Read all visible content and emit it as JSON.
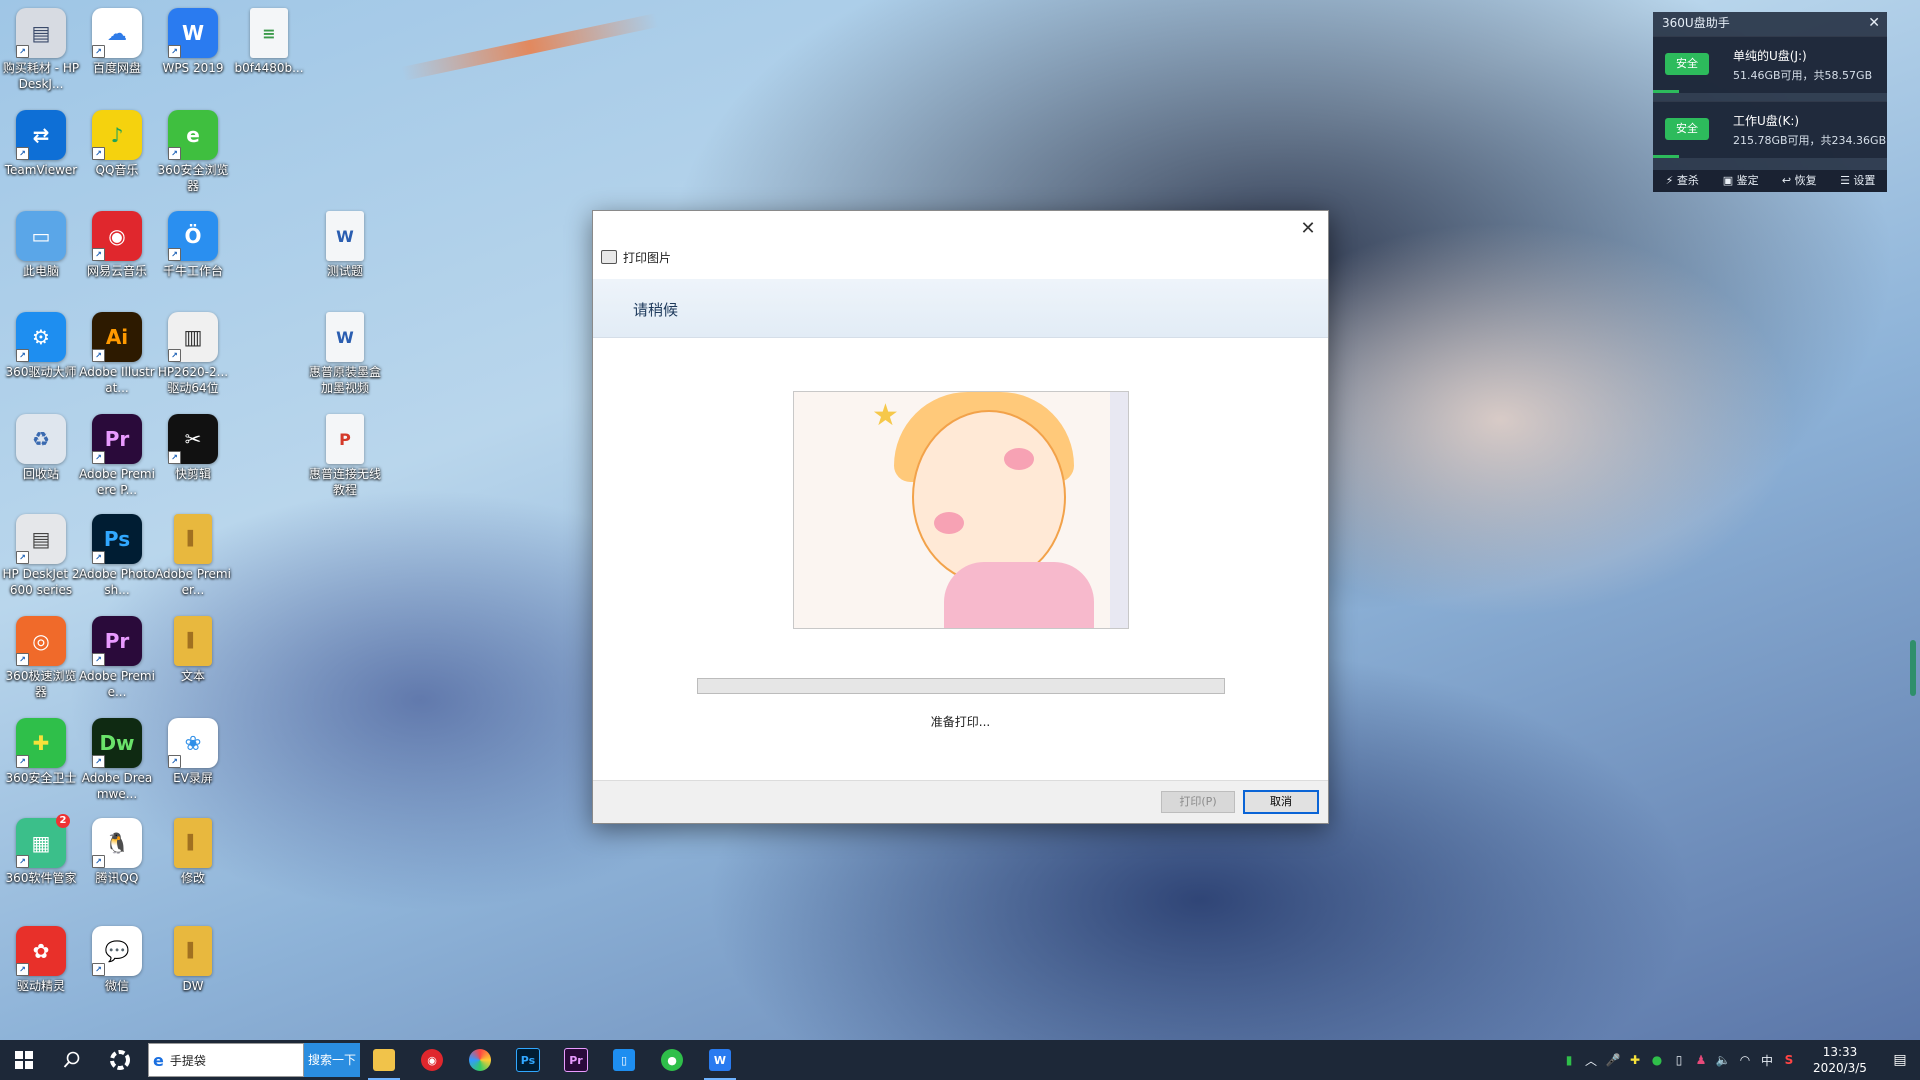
{
  "desktop_icons": [
    {
      "label": "购买耗材 - HP DeskJ...",
      "glyph": "▤",
      "color": "#d7dbe2",
      "glyph_color": "#3a4a6a",
      "shortcut": true
    },
    {
      "label": "百度网盘",
      "glyph": "☁",
      "color": "#ffffff",
      "glyph_color": "#2f7be8",
      "shortcut": true
    },
    {
      "label": "WPS 2019",
      "glyph": "W",
      "color": "#2a7bf0",
      "glyph_color": "#ffffff",
      "shortcut": true
    },
    {
      "label": "b0f4480b...",
      "glyph": "≡",
      "color": "#f4f6f8",
      "glyph_color": "#3a9a4a",
      "shortcut": false,
      "kind": "doc"
    },
    {
      "label": "TeamViewer",
      "glyph": "⇄",
      "color": "#0e6fd6",
      "glyph_color": "#ffffff",
      "shortcut": true
    },
    {
      "label": "QQ音乐",
      "glyph": "♪",
      "color": "#f5d20e",
      "glyph_color": "#1fa35a",
      "shortcut": true
    },
    {
      "label": "360安全浏览器",
      "glyph": "e",
      "color": "#3fbf3f",
      "glyph_color": "#ffffff",
      "shortcut": true
    },
    {
      "label": "此电脑",
      "glyph": "▭",
      "color": "#5aa6e8",
      "glyph_color": "#ffffff",
      "shortcut": false
    },
    {
      "label": "网易云音乐",
      "glyph": "◉",
      "color": "#e0272d",
      "glyph_color": "#ffffff",
      "shortcut": true
    },
    {
      "label": "千牛工作台",
      "glyph": "Ö",
      "color": "#2a8ff0",
      "glyph_color": "#ffffff",
      "shortcut": true
    },
    {
      "label": "测试题",
      "glyph": "W",
      "color": "#f4f6f8",
      "glyph_color": "#2a5db0",
      "shortcut": false,
      "kind": "doc"
    },
    {
      "label": "360驱动大师",
      "glyph": "⚙",
      "color": "#1e8ef0",
      "glyph_color": "#ffffff",
      "shortcut": true
    },
    {
      "label": "Adobe Illustrat...",
      "glyph": "Ai",
      "color": "#2d1a00",
      "glyph_color": "#ff9a00",
      "shortcut": true
    },
    {
      "label": "HP2620-2... 驱动64位",
      "glyph": "▥",
      "color": "#f0f0f0",
      "glyph_color": "#333333",
      "shortcut": true
    },
    {
      "label": "惠普原装墨盒加墨视频",
      "glyph": "W",
      "color": "#f4f6f8",
      "glyph_color": "#2a5db0",
      "shortcut": false,
      "kind": "doc"
    },
    {
      "label": "回收站",
      "glyph": "♻",
      "color": "#dfe6ee",
      "glyph_color": "#3a6ab0",
      "shortcut": false
    },
    {
      "label": "Adobe Premiere P...",
      "glyph": "Pr",
      "color": "#2a0a3a",
      "glyph_color": "#e99bff",
      "shortcut": true
    },
    {
      "label": "快剪辑",
      "glyph": "✂",
      "color": "#111111",
      "glyph_color": "#ffffff",
      "shortcut": true
    },
    {
      "label": "惠普连接无线教程",
      "glyph": "P",
      "color": "#f4f6f8",
      "glyph_color": "#d43a2a",
      "shortcut": false,
      "kind": "doc"
    },
    {
      "label": "HP DeskJet 2600 series",
      "glyph": "▤",
      "color": "#e5e7ea",
      "glyph_color": "#444444",
      "shortcut": true
    },
    {
      "label": "Adobe Photosh...",
      "glyph": "Ps",
      "color": "#001d33",
      "glyph_color": "#31a8ff",
      "shortcut": true
    },
    {
      "label": "Adobe Premier...",
      "glyph": "▌",
      "color": "#e8b83e",
      "glyph_color": "#a07020",
      "shortcut": false,
      "kind": "folder"
    },
    {
      "label": "360极速浏览器",
      "glyph": "◎",
      "color": "#f06a2a",
      "glyph_color": "#ffffff",
      "shortcut": true
    },
    {
      "label": "Adobe Premie...",
      "glyph": "Pr",
      "color": "#2a0a3a",
      "glyph_color": "#e99bff",
      "shortcut": true
    },
    {
      "label": "文本",
      "glyph": "▌",
      "color": "#e8b83e",
      "glyph_color": "#a07020",
      "shortcut": false,
      "kind": "folder"
    },
    {
      "label": "360安全卫士",
      "glyph": "✚",
      "color": "#2fbf4a",
      "glyph_color": "#f7e23a",
      "shortcut": true
    },
    {
      "label": "Adobe Dreamwe...",
      "glyph": "Dw",
      "color": "#0f2a12",
      "glyph_color": "#6ae36a",
      "shortcut": true
    },
    {
      "label": "EV录屏",
      "glyph": "❀",
      "color": "#ffffff",
      "glyph_color": "#2f8fe8",
      "shortcut": true
    },
    {
      "label": "360软件管家",
      "glyph": "▦",
      "color": "#3bbf8a",
      "glyph_color": "#ffffff",
      "shortcut": true,
      "badge": "2"
    },
    {
      "label": "腾讯QQ",
      "glyph": "🐧",
      "color": "#ffffff",
      "glyph_color": "#111111",
      "shortcut": true
    },
    {
      "label": "修改",
      "glyph": "▌",
      "color": "#e8b83e",
      "glyph_color": "#a07020",
      "shortcut": false,
      "kind": "folder"
    },
    {
      "label": "驱动精灵",
      "glyph": "✿",
      "color": "#e8302a",
      "glyph_color": "#ffffff",
      "shortcut": true
    },
    {
      "label": "微信",
      "glyph": "💬",
      "color": "#ffffff",
      "glyph_color": "#2fbf4a",
      "shortcut": true
    },
    {
      "label": "DW",
      "glyph": "▌",
      "color": "#e8b83e",
      "glyph_color": "#a07020",
      "shortcut": false,
      "kind": "folder"
    }
  ],
  "u360": {
    "title": "360U盘助手",
    "close": "✕",
    "drives": [
      {
        "badge": "安全",
        "name": "单纯的U盘(J:)",
        "info": "51.46GB可用，共58.57GB"
      },
      {
        "badge": "安全",
        "name": "工作U盘(K:)",
        "info": "215.78GB可用，共234.36GB"
      }
    ],
    "tools": [
      "⚡ 查杀",
      "▣ 鉴定",
      "↩ 恢复",
      "☰ 设置"
    ]
  },
  "dialog": {
    "close": "✕",
    "title": "打印图片",
    "heading": "请稍候",
    "progress": 0,
    "status": "准备打印...",
    "print_button": "打印(P)",
    "cancel_button": "取消"
  },
  "taskbar": {
    "search_value": "手提袋",
    "search_button": "搜索一下",
    "clock_time": "13:33",
    "clock_date": "2020/3/5",
    "input_method": "中",
    "tray_icons": [
      "battery-icon",
      "chevron-up-icon",
      "mic-icon",
      "360-guard-icon",
      "wechat-tray-icon",
      "usb-icon",
      "qq-tray-icon",
      "volume-icon",
      "wifi-icon"
    ]
  }
}
